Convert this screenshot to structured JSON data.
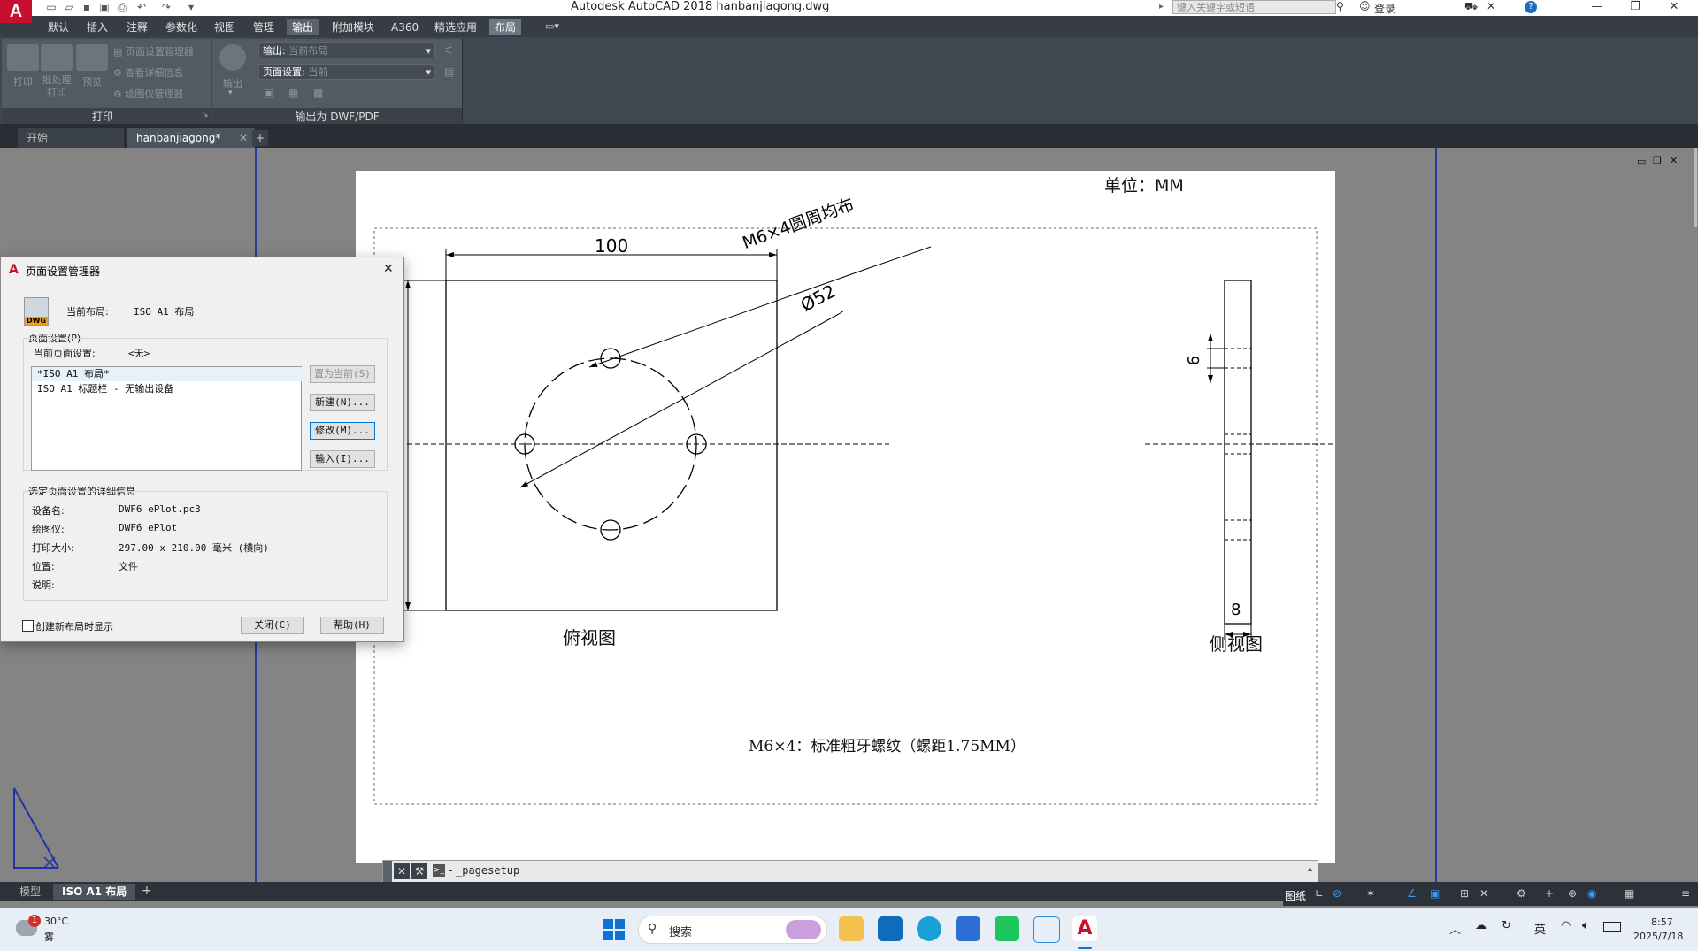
{
  "window": {
    "title": "Autodesk AutoCAD 2018    hanbanjiagong.dwg",
    "search_placeholder": "键入关键字或短语",
    "login": "登录",
    "help": "?"
  },
  "menu_tabs": [
    "默认",
    "插入",
    "注释",
    "参数化",
    "视图",
    "管理",
    "输出",
    "附加模块",
    "A360",
    "精选应用",
    "布局"
  ],
  "ribbon": {
    "print_panel": {
      "title": "打印",
      "buttons": [
        "打印",
        "批处理\n打印",
        "预览"
      ],
      "small": [
        "页面设置管理器",
        "查看详细信息",
        "绘图仪管理器"
      ]
    },
    "export_panel": {
      "title": "输出为 DWF/PDF",
      "export_label": "输出",
      "export_label_field": "输出:",
      "export_value": "当前布局",
      "pagesetup_label": "页面设置:",
      "pagesetup_value": "当前"
    }
  },
  "doc_tabs": [
    "开始",
    "hanbanjiagong*"
  ],
  "drawing": {
    "unit_text": "单位：MM",
    "dim_100": "100",
    "dim_thread": "M6×4圆周均布",
    "dim_dia": "Ø52",
    "dim_6": "6",
    "dim_8": "8",
    "top_view_label": "俯视图",
    "side_view_label": "侧视图",
    "note": "M6×4：标准粗牙螺纹（螺距1.75MM）"
  },
  "dialog": {
    "title": "页面设置管理器",
    "current_layout_label": "当前布局:",
    "current_layout_value": "ISO A1 布局",
    "dwg_badge": "DWG",
    "group_pagesetup": "页面设置(P)",
    "current_pagesetup_label": "当前页面设置:",
    "current_pagesetup_value": "<无>",
    "list_items": [
      "*ISO A1 布局*",
      "ISO A1 标题栏 - 无输出设备"
    ],
    "btn_set_current": "置为当前(S)",
    "btn_new": "新建(N)...",
    "btn_modify": "修改(M)...",
    "btn_import": "输入(I)...",
    "group_details": "选定页面设置的详细信息",
    "details": [
      {
        "label": "设备名:",
        "value": "DWF6 ePlot.pc3"
      },
      {
        "label": "绘图仪:",
        "value": "DWF6 ePlot"
      },
      {
        "label": "打印大小:",
        "value": "297.00 x 210.00 毫米 (横向)"
      },
      {
        "label": "位置:",
        "value": "文件"
      },
      {
        "label": "说明:",
        "value": ""
      }
    ],
    "checkbox_label": "创建新布局时显示",
    "btn_close": "关闭(C)",
    "btn_help": "帮助(H)"
  },
  "command_line": {
    "text": "_pagesetup",
    "prompt": "-"
  },
  "layout_tabs": [
    "模型",
    "ISO A1 布局"
  ],
  "status_bar": {
    "model_label": "图纸"
  },
  "taskbar": {
    "weather_temp": "30°C",
    "weather_desc": "雾",
    "weather_badge": "1",
    "search_label": "搜索",
    "ime": "英",
    "time": "8:57",
    "date": "2025/7/18"
  }
}
